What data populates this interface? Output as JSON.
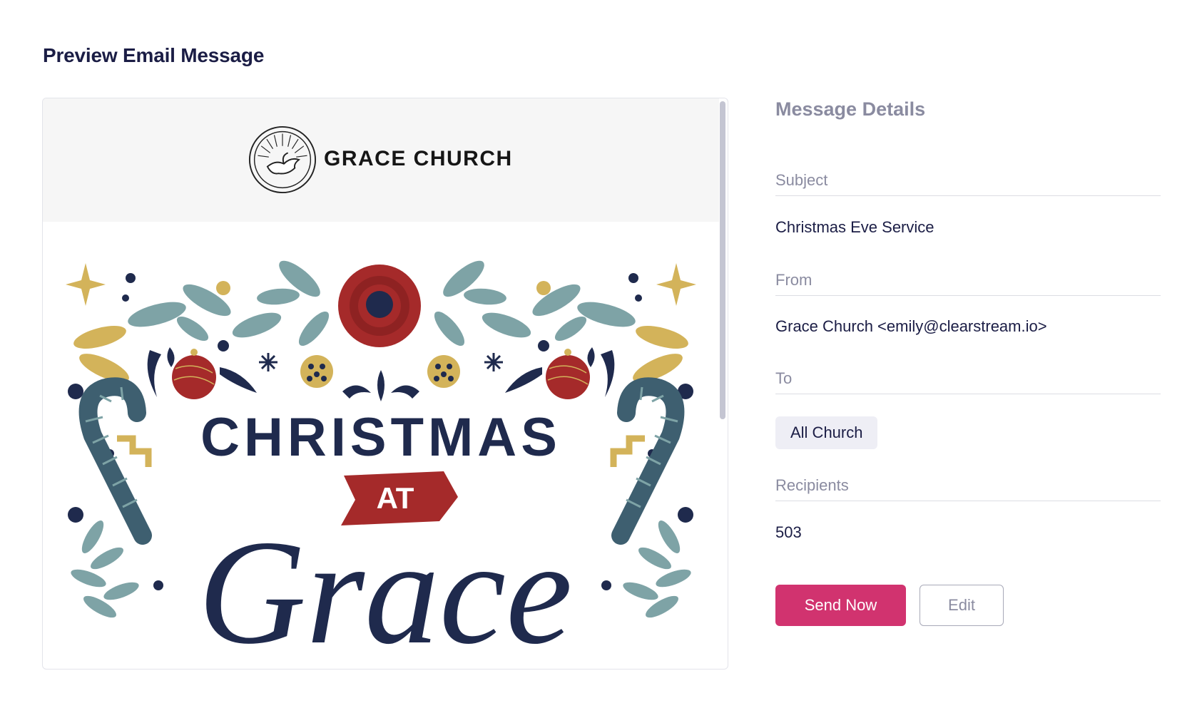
{
  "page": {
    "title": "Preview Email Message"
  },
  "email_preview": {
    "church_name": "GRACE CHURCH",
    "hero_heading": "CHRISTMAS",
    "hero_banner": "AT",
    "hero_script": "Grace"
  },
  "details": {
    "title": "Message Details",
    "subject_label": "Subject",
    "subject_value": "Christmas Eve Service",
    "from_label": "From",
    "from_value": "Grace Church <emily@clearstream.io>",
    "to_label": "To",
    "to_tag": "All Church",
    "recipients_label": "Recipients",
    "recipients_value": "503"
  },
  "actions": {
    "send_label": "Send Now",
    "edit_label": "Edit"
  },
  "colors": {
    "accent": "#d1336f",
    "navy": "#1f2a4d",
    "sage": "#7ea3a6",
    "gold": "#d3b35a",
    "red": "#a52a2a",
    "cane": "#3e5f70"
  }
}
